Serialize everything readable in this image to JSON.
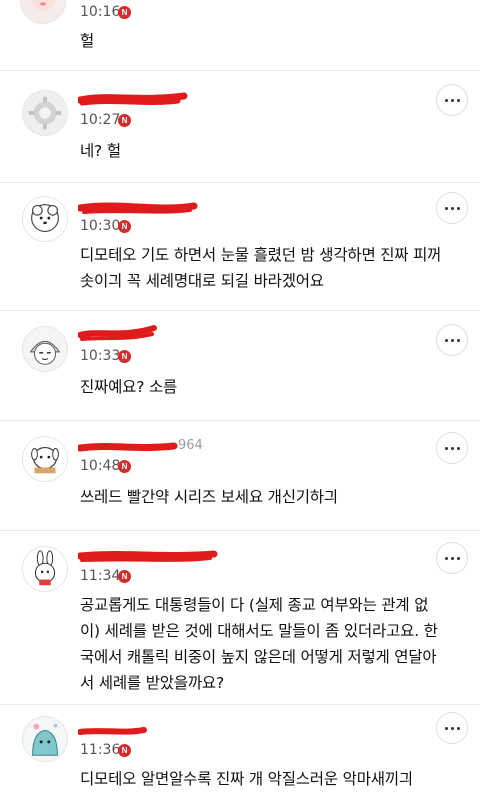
{
  "badge_letter": "N",
  "colors": {
    "badge": "#d52b2b",
    "redaction": "#e01b1b"
  },
  "comments": [
    {
      "name_visible": "",
      "time": "10:16",
      "text": "헐"
    },
    {
      "name_visible": "",
      "time": "10:27",
      "text": "네? 헐"
    },
    {
      "name_visible": "",
      "time": "10:30",
      "text": "디모테오 기도 하면서 눈물 흘렸던 밤 생각하면 진짜 피꺼\n솟이긔 꼭 세례명대로 되길 바라겠어요"
    },
    {
      "name_visible": "",
      "time": "10:33",
      "text": "진짜예요? 소름"
    },
    {
      "name_visible": "964",
      "time": "10:48",
      "text": "쓰레드 빨간약 시리즈 보세요 개신기하긔"
    },
    {
      "name_visible": "",
      "time": "11:34",
      "text": "공교롭게도 대통령들이 다 (실제 종교 여부와는 관계 없\n이) 세례를 받은 것에 대해서도 말들이 좀 있더라고요. 한\n국에서 캐톨릭 비중이 높지 않은데 어떻게 저렇게 연달아\n서 세례를 받았을까요?"
    },
    {
      "name_visible": "",
      "time": "11:36",
      "text": "디모테오 알면알수록 진짜 개 악질스러운 악마새끼긔"
    }
  ]
}
